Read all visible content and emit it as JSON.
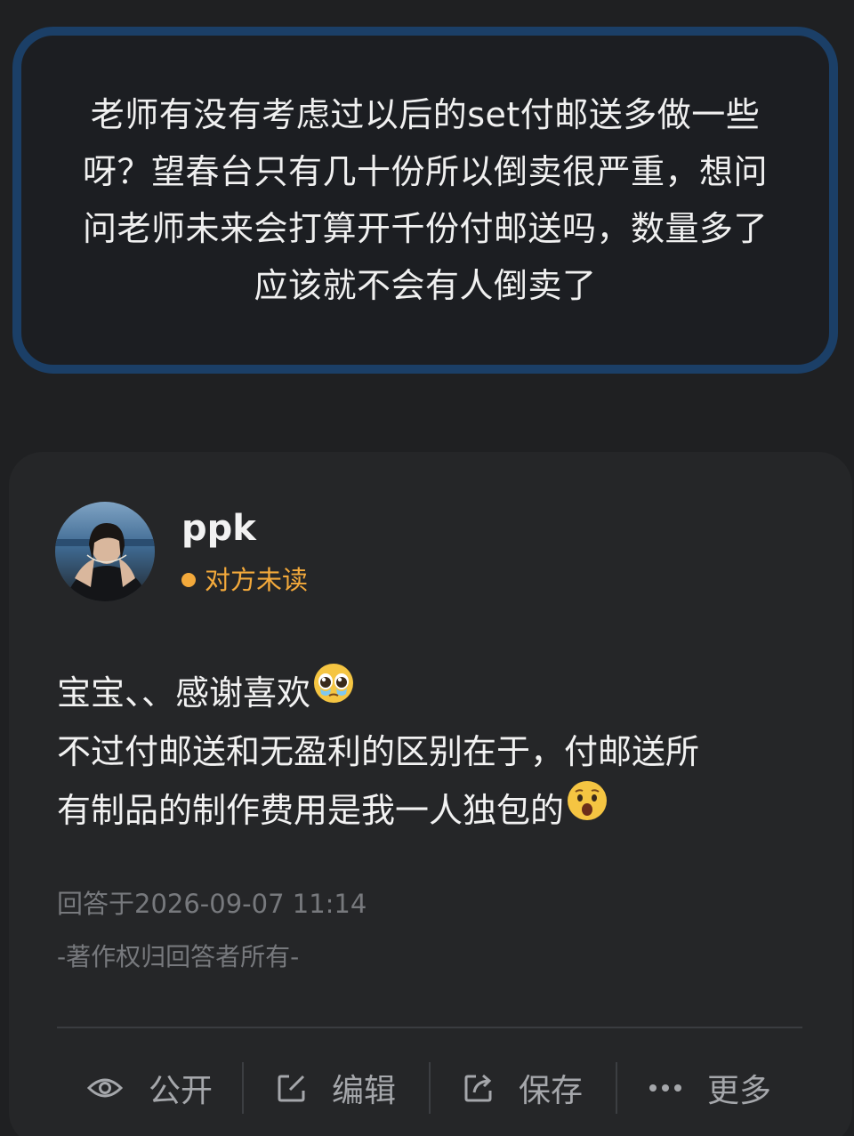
{
  "question": {
    "text": "老师有没有考虑过以后的set付邮送多做一些呀？望春台只有几十份所以倒卖很严重，想问问老师未来会打算开千份付邮送吗，数量多了应该就不会有人倒卖了"
  },
  "answer": {
    "username": "ppk",
    "read_status": "对方未读",
    "status_color": "#f3a93b",
    "lines": [
      "宝宝、、感谢喜欢",
      "不过付邮送和无盈利的区别在于，付邮送所",
      "有制品的制作费用是我一人独包的"
    ],
    "emojis": [
      "pleading-face-icon",
      "hushed-face-icon"
    ],
    "timestamp": "回答于2026-09-07 11:14",
    "copyright": "-著作权归回答者所有-"
  },
  "actions": {
    "public_label": "公开",
    "edit_label": "编辑",
    "save_label": "保存",
    "more_label": "更多"
  },
  "colors": {
    "background": "#1f2022",
    "card_border": "#1b3f67",
    "answer_card": "#252628",
    "muted_text": "#77797d"
  }
}
